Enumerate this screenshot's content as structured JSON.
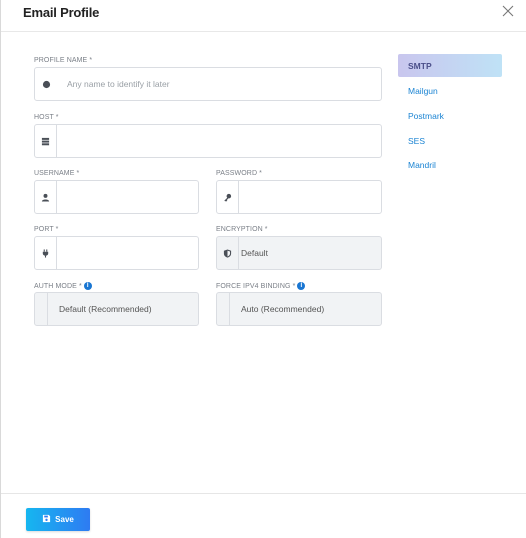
{
  "header": {
    "title": "Email Profile",
    "close_icon": "close-icon"
  },
  "form": {
    "profile_name": {
      "label": "PROFILE NAME *",
      "placeholder": "Any name to identify it later",
      "icon": "circle-icon"
    },
    "host": {
      "label": "HOST *",
      "value": "",
      "icon": "server-icon"
    },
    "username": {
      "label": "USERNAME *",
      "value": "",
      "icon": "user-icon"
    },
    "password": {
      "label": "PASSWORD *",
      "value": "",
      "icon": "key-icon"
    },
    "port": {
      "label": "PORT *",
      "value": "",
      "icon": "plug-icon"
    },
    "encryption": {
      "label": "ENCRYPTION *",
      "value": "Default",
      "icon": "shield-icon"
    },
    "auth_mode": {
      "label": "AUTH MODE *",
      "value": "Default (Recommended)",
      "info_icon": "info-icon"
    },
    "ipv4_binding": {
      "label": "FORCE IPV4 BINDING *",
      "value": "Auto (Recommended)",
      "info_icon": "info-icon"
    }
  },
  "providers": {
    "items": [
      {
        "label": "SMTP",
        "active": true
      },
      {
        "label": "Mailgun",
        "active": false
      },
      {
        "label": "Postmark",
        "active": false
      },
      {
        "label": "SES",
        "active": false
      },
      {
        "label": "Mandril",
        "active": false
      }
    ]
  },
  "footer": {
    "save_label": "Save",
    "save_icon": "floppy-disk-icon"
  },
  "colors": {
    "accent": "#1b84d3",
    "button_start": "#16b6f0",
    "button_end": "#2e7bf2",
    "active_tab_start": "#c9c6ee",
    "active_tab_end": "#bfe2f6"
  }
}
